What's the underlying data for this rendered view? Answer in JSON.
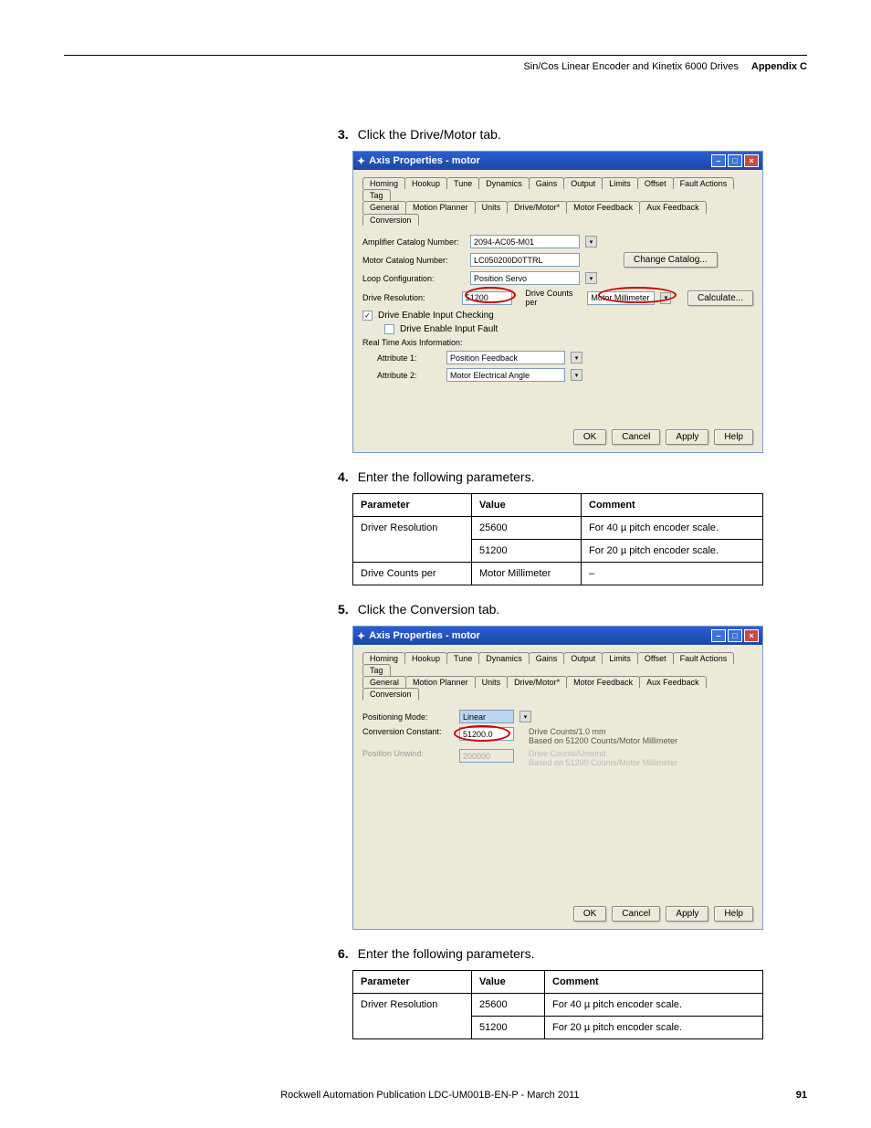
{
  "header": {
    "title": "Sin/Cos Linear Encoder and Kinetix 6000 Drives",
    "appendix": "Appendix C"
  },
  "steps": {
    "s3": {
      "num": "3.",
      "text": "Click the Drive/Motor tab."
    },
    "s4": {
      "num": "4.",
      "text": "Enter the following parameters."
    },
    "s5": {
      "num": "5.",
      "text": "Click the Conversion tab."
    },
    "s6": {
      "num": "6.",
      "text": "Enter the following parameters."
    }
  },
  "win1": {
    "title": "Axis Properties - motor",
    "tabs_row1": [
      "Homing",
      "Hookup",
      "Tune",
      "Dynamics",
      "Gains",
      "Output",
      "Limits",
      "Offset",
      "Fault Actions",
      "Tag"
    ],
    "tabs_row2": [
      "General",
      "Motion Planner",
      "Units",
      "Drive/Motor*",
      "Motor Feedback",
      "Aux Feedback",
      "Conversion"
    ],
    "amp_label": "Amplifier Catalog Number:",
    "amp_val": "2094-AC05-M01",
    "motor_label": "Motor Catalog Number:",
    "motor_val": "LC050200D0TTRL",
    "change_btn": "Change Catalog...",
    "loop_label": "Loop Configuration:",
    "loop_val": "Position Servo",
    "res_label": "Drive Resolution:",
    "res_val": "51200",
    "counts_label": "Drive Counts per",
    "counts_unit": "Motor Millimeter",
    "calc_btn": "Calculate...",
    "chk1": "Drive Enable Input Checking",
    "chk2": "Drive Enable Input Fault",
    "rtai": "Real Time Axis Information:",
    "attr1_label": "Attribute 1:",
    "attr1_val": "Position Feedback",
    "attr2_label": "Attribute 2:",
    "attr2_val": "Motor Electrical Angle"
  },
  "table1": {
    "h1": "Parameter",
    "h2": "Value",
    "h3": "Comment",
    "rows": [
      {
        "p": "Driver Resolution",
        "v": "25600",
        "c": "For 40 µ pitch encoder scale."
      },
      {
        "p": "",
        "v": "51200",
        "c": "For 20 µ pitch encoder scale."
      },
      {
        "p": "Drive Counts per",
        "v": "Motor Millimeter",
        "c": "–"
      }
    ]
  },
  "win2": {
    "title": "Axis Properties - motor",
    "tabs_row1": [
      "Homing",
      "Hookup",
      "Tune",
      "Dynamics",
      "Gains",
      "Output",
      "Limits",
      "Offset",
      "Fault Actions",
      "Tag"
    ],
    "tabs_row2": [
      "General",
      "Motion Planner",
      "Units",
      "Drive/Motor*",
      "Motor Feedback",
      "Aux Feedback",
      "Conversion"
    ],
    "pos_mode_label": "Positioning Mode:",
    "pos_mode_val": "Linear",
    "conv_label": "Conversion Constant:",
    "conv_val": "51200.0",
    "conv_hint1": "Drive Counts/1.0 mm",
    "conv_hint2": "Based on 51200 Counts/Motor Millimeter",
    "unwind_label": "Position Unwind:",
    "unwind_val": "200000",
    "unwind_hint1": "Drive Counts/Unwind",
    "unwind_hint2": "Based on 51200 Counts/Motor Millimeter"
  },
  "table2": {
    "h1": "Parameter",
    "h2": "Value",
    "h3": "Comment",
    "rows": [
      {
        "p": "Driver Resolution",
        "v": "25600",
        "c": "For 40 µ pitch encoder scale."
      },
      {
        "p": "",
        "v": "51200",
        "c": "For 20 µ pitch encoder scale."
      }
    ]
  },
  "buttons": {
    "ok": "OK",
    "cancel": "Cancel",
    "apply": "Apply",
    "help": "Help"
  },
  "footer": {
    "pub": "Rockwell Automation Publication LDC-UM001B-EN-P - March 2011",
    "page": "91"
  }
}
